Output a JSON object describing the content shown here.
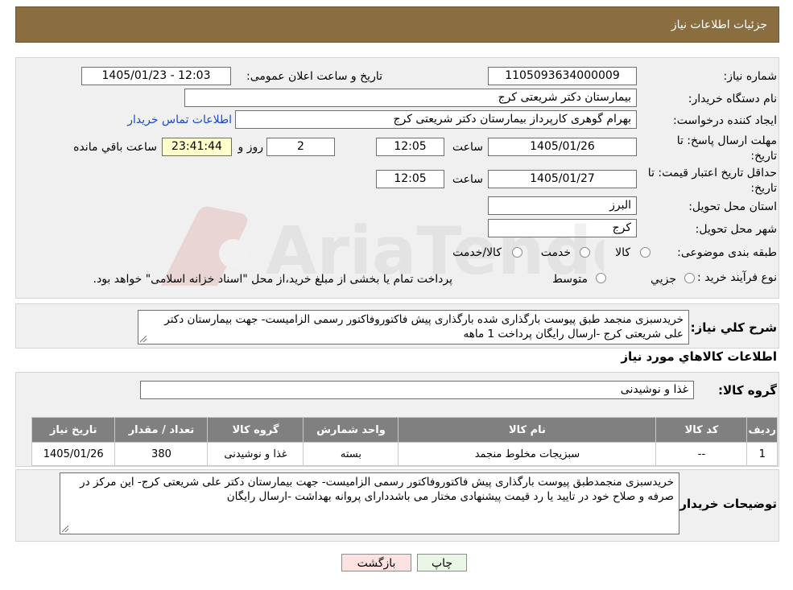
{
  "header": {
    "title": "جزئیات اطلاعات نیاز"
  },
  "labels": {
    "need_no": "شماره نیاز:",
    "announce_dt": "تاریخ و ساعت اعلان عمومی:",
    "buyer_org": "نام دستگاه خریدار:",
    "requester": "ایجاد کننده درخواست:",
    "deadline_line1": "مهلت ارسال پاسخ: تا",
    "deadline_line2": "تاریخ:",
    "validity_line1": "حداقل تاریخ اعتبار قیمت: تا",
    "validity_line2": "تاریخ:",
    "time": "ساعت",
    "day_and": "روز و",
    "remaining": "ساعت باقي مانده",
    "province": "استان محل تحویل:",
    "city": "شهر محل تحویل:",
    "category": "طبقه بندی موضوعی:",
    "process": "نوع فرآیند خرید :",
    "general_desc": "شرح کلي نیاز:",
    "goods_info": "اطلاعات کالاهاي مورد نیاز",
    "goods_group": "گروه کالا:",
    "buyer_notes": "توضیحات خریدار:"
  },
  "values": {
    "need_no": "1105093634000009",
    "announce_dt": "1405/01/23 - 12:03",
    "buyer_org": "بیمارستان دکتر شریعتی کرج",
    "requester": "بهرام گوهری کارپرداز بیمارستان دکتر شریعتی کرج",
    "contact_link": "اطلاعات تماس خریدار",
    "deadline_date": "1405/01/26",
    "deadline_time": "12:05",
    "days": "2",
    "countdown": "23:41:44",
    "validity_date": "1405/01/27",
    "validity_time": "12:05",
    "province": "البرز",
    "city": "کرج",
    "general_desc": "خریدسبزی منجمد طبق پیوست بارگذاری شده بارگذاری پیش فاکتوروفاکتور رسمی الزامیست- جهت بیمارستان دکتر علی شریعتی کرج -ارسال رایگان پرداخت 1 ماهه",
    "goods_group": "غذا و نوشیدنی",
    "buyer_notes": "خریدسبزی منجمدطبق پیوست بارگذاری پیش فاکتوروفاکتور رسمی الزامیست- جهت بیمارستان دکتر علی شریعتی کرج- این مرکز در صرفه و صلاح خود در تایید یا رد قیمت پیشنهادی مختار می باشددارای پروانه بهداشت -ارسال رایگان"
  },
  "category_options": [
    "کالا",
    "خدمت",
    "کالا/خدمت"
  ],
  "process_options": [
    "جزیي",
    "متوسط"
  ],
  "process_note": "پرداخت تمام یا بخشی از مبلغ خرید،از محل \"اسناد خزانه اسلامی\" خواهد بود.",
  "table": {
    "headers": [
      "ردیف",
      "کد کالا",
      "نام کالا",
      "واحد شمارش",
      "گروه کالا",
      "تعداد / مقدار",
      "تاریخ نیاز"
    ],
    "rows": [
      [
        "1",
        "--",
        "سبزیجات مخلوط منجمد",
        "بسته",
        "غذا و نوشیدنی",
        "380",
        "1405/01/26"
      ]
    ]
  },
  "buttons": {
    "print": "چاپ",
    "back": "بازگشت"
  },
  "watermark": {
    "text": "AriaTender.neT"
  },
  "colors": {
    "header_bg": "#8b6e3f",
    "panel_bg": "#f0f0f0",
    "table_header_bg": "#808080",
    "countdown_bg": "#ffffcc",
    "back_btn_bg": "#fde2e2",
    "print_btn_bg": "#eaf7e6",
    "link": "#1a49c9"
  }
}
